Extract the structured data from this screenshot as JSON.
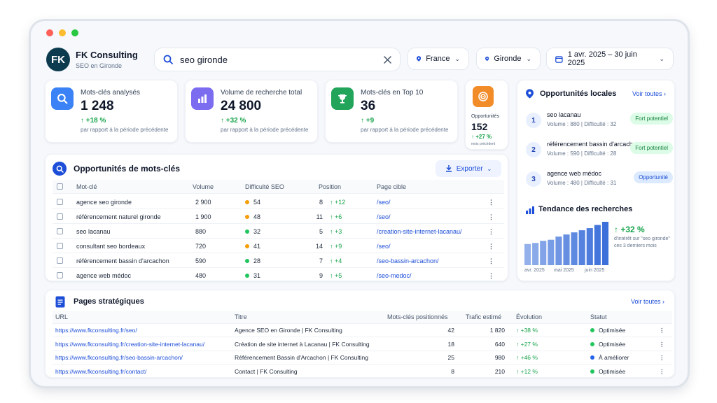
{
  "brand": {
    "initials": "FK",
    "name": "FK Consulting",
    "subtitle": "SEO en Gironde"
  },
  "search": {
    "value": "seo gironde"
  },
  "filters": {
    "country": "France",
    "region": "Gironde",
    "date_range": "1 avr. 2025 – 30 juin 2025"
  },
  "kpis": [
    {
      "label": "Mots-clés analysés",
      "value": "1 248",
      "delta": "↑ +18 %",
      "sub": "par rapport à la période précédente",
      "color": "#3b82f6"
    },
    {
      "label": "Volume de recherche total",
      "value": "24 800",
      "delta": "↑ +32 %",
      "sub": "par rapport à la période précédente",
      "color": "#7c6cf0"
    },
    {
      "label": "Mots-clés en Top 10",
      "value": "36",
      "delta": "↑ +9",
      "sub": "par rapport à la période précédente",
      "color": "#22a55a"
    }
  ],
  "mini_kpi": {
    "label": "Opportunités",
    "value": "152",
    "delta": "↑ +27 %",
    "sub": "mois précédent",
    "color": "#f28c28"
  },
  "keywords": {
    "title": "Opportunités de mots-clés",
    "export_label": "Exporter",
    "headers": {
      "keyword": "Mot-clé",
      "volume": "Volume",
      "difficulty": "Difficulté SEO",
      "position": "Position",
      "page": "Page cible"
    },
    "rows": [
      {
        "keyword": "agence seo gironde",
        "volume": "2 900",
        "difficulty": "54",
        "dcolor": "#f59e0b",
        "position": "8",
        "change": "↑ +12",
        "page": "/seo/"
      },
      {
        "keyword": "référencement naturel gironde",
        "volume": "1 900",
        "difficulty": "48",
        "dcolor": "#f59e0b",
        "position": "11",
        "change": "↑ +6",
        "page": "/seo/"
      },
      {
        "keyword": "seo lacanau",
        "volume": "880",
        "difficulty": "32",
        "dcolor": "#22c55e",
        "position": "5",
        "change": "↑ +3",
        "page": "/creation-site-internet-lacanau/"
      },
      {
        "keyword": "consultant seo bordeaux",
        "volume": "720",
        "difficulty": "41",
        "dcolor": "#f59e0b",
        "position": "14",
        "change": "↑ +9",
        "page": "/seo/"
      },
      {
        "keyword": "référencement bassin d'arcachon",
        "volume": "590",
        "difficulty": "28",
        "dcolor": "#22c55e",
        "position": "7",
        "change": "↑ +4",
        "page": "/seo-bassin-arcachon/"
      },
      {
        "keyword": "agence web médoc",
        "volume": "480",
        "difficulty": "31",
        "dcolor": "#22c55e",
        "position": "9",
        "change": "↑ +5",
        "page": "/seo-medoc/"
      }
    ]
  },
  "local": {
    "title": "Opportunités locales",
    "see_all": "Voir toutes",
    "items": [
      {
        "num": "1",
        "title": "seo lacanau",
        "meta": "Volume : 880  |  Difficulté : 32",
        "tag": "Fort potentiel",
        "tag_bg": "#dcfce7",
        "tag_fg": "#15803d"
      },
      {
        "num": "2",
        "title": "référencement bassin d'arcachon",
        "meta": "Volume : 590  |  Difficulté : 28",
        "tag": "Fort potentiel",
        "tag_bg": "#dcfce7",
        "tag_fg": "#15803d"
      },
      {
        "num": "3",
        "title": "agence web médoc",
        "meta": "Volume : 480  |  Difficulté : 31",
        "tag": "Opportunité",
        "tag_bg": "#dbeafe",
        "tag_fg": "#1d4ed8"
      }
    ]
  },
  "trend": {
    "title": "Tendance des recherches",
    "delta": "↑ +32 %",
    "caption": "d'intérêt sur \"seo gironde\" ces 3 derniers mois",
    "x_labels": [
      "avr. 2025",
      "mai 2025",
      "juin 2025"
    ],
    "values": [
      40,
      42,
      46,
      48,
      54,
      58,
      62,
      66,
      70,
      76,
      82
    ]
  },
  "pages": {
    "title": "Pages stratégiques",
    "see_all": "Voir toutes",
    "headers": {
      "url": "URL",
      "title": "Titre",
      "keywords": "Mots-clés positionnés",
      "traffic": "Trafic estimé",
      "evolution": "Évolution",
      "status": "Statut"
    },
    "rows": [
      {
        "url": "https://www.fkconsulting.fr/seo/",
        "title": "Agence SEO en Gironde | FK Consulting",
        "keywords": "42",
        "traffic": "1 820",
        "evolution": "↑ +38 %",
        "status": "Optimisée",
        "scolor": "#22c55e"
      },
      {
        "url": "https://www.fkconsulting.fr/creation-site-internet-lacanau/",
        "title": "Création de site internet à Lacanau | FK Consulting",
        "keywords": "18",
        "traffic": "640",
        "evolution": "↑ +27 %",
        "status": "Optimisée",
        "scolor": "#22c55e"
      },
      {
        "url": "https://www.fkconsulting.fr/seo-bassin-arcachon/",
        "title": "Référencement Bassin d'Arcachon | FK Consulting",
        "keywords": "25",
        "traffic": "980",
        "evolution": "↑ +46 %",
        "status": "À améliorer",
        "scolor": "#2563eb"
      },
      {
        "url": "https://www.fkconsulting.fr/contact/",
        "title": "Contact | FK Consulting",
        "keywords": "8",
        "traffic": "210",
        "evolution": "↑ +12 %",
        "status": "Optimisée",
        "scolor": "#22c55e"
      }
    ]
  }
}
